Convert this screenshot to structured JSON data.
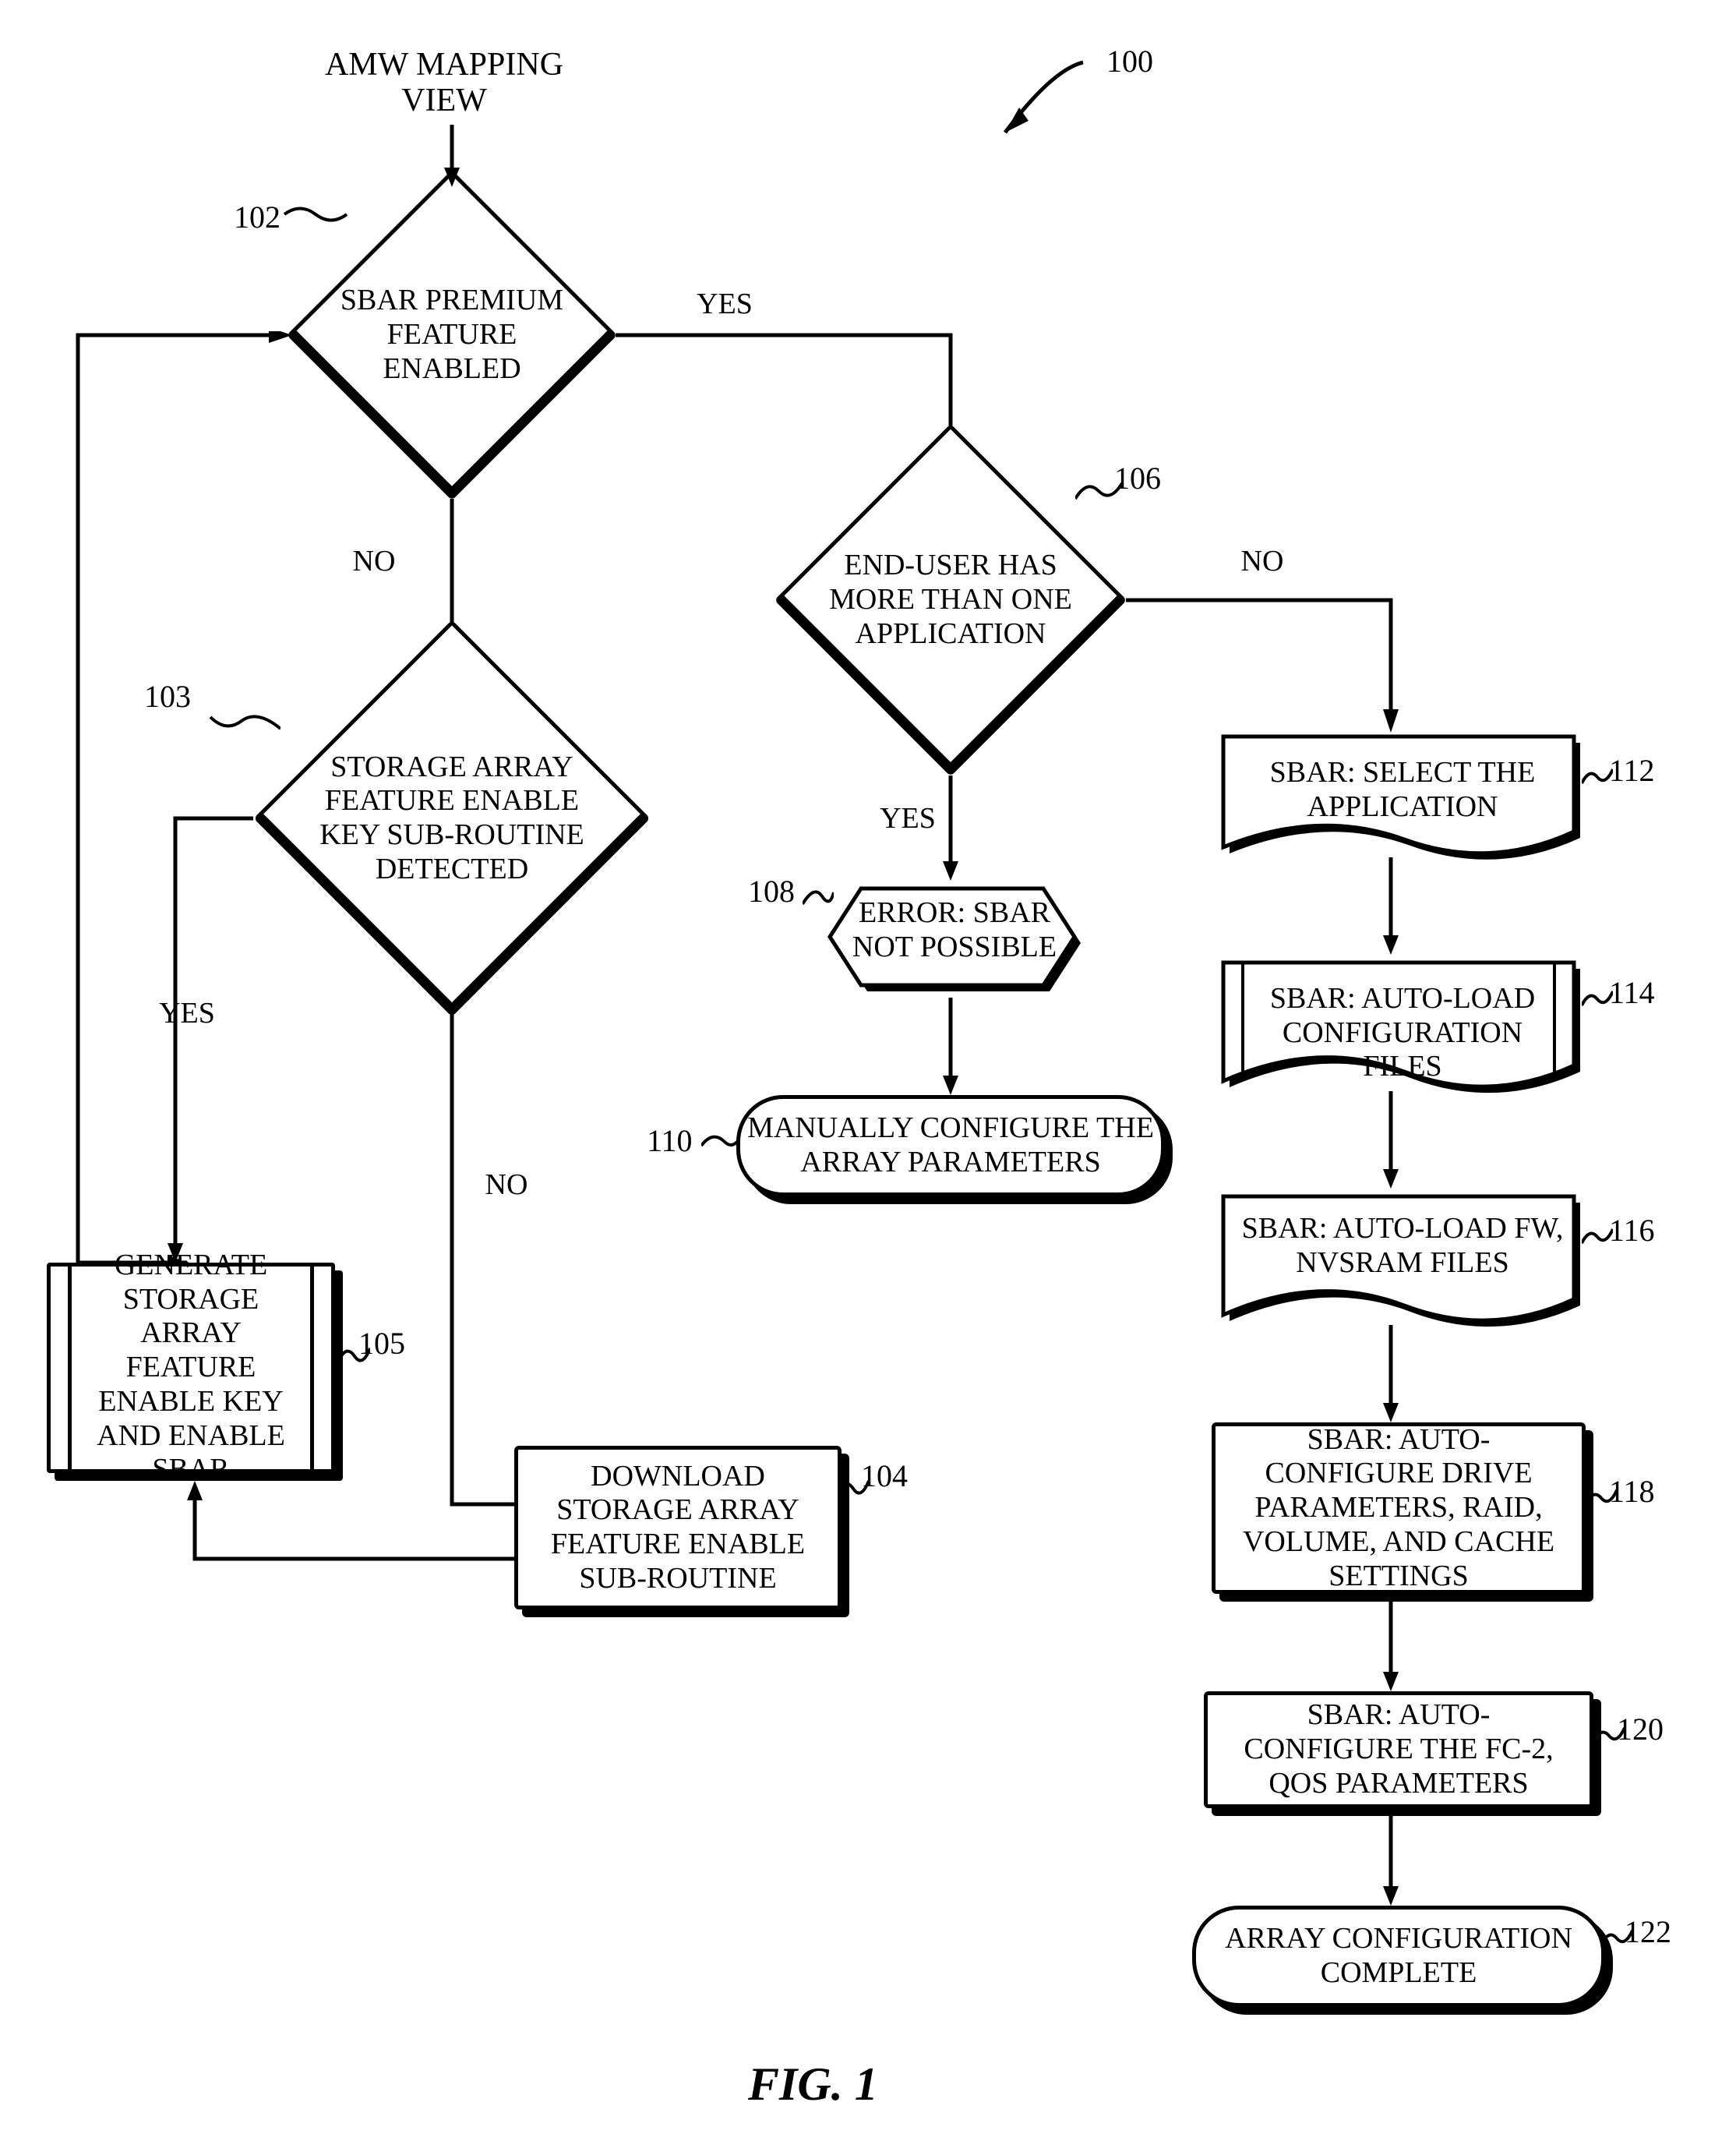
{
  "title": "AMW MAPPING VIEW",
  "ref_arrow": "100",
  "caption": "FIG. 1",
  "nodes": {
    "d102": {
      "text": "SBAR PREMIUM FEATURE ENABLED",
      "ref": "102"
    },
    "d103": {
      "text": "STORAGE ARRAY FEATURE ENABLE KEY SUB-ROUTINE DETECTED",
      "ref": "103"
    },
    "p105": {
      "text": "GENERATE STORAGE ARRAY FEATURE ENABLE KEY AND ENABLE SBAR",
      "ref": "105"
    },
    "p104": {
      "text": "DOWNLOAD STORAGE ARRAY FEATURE ENABLE SUB-ROUTINE",
      "ref": "104"
    },
    "d106": {
      "text": "END-USER HAS MORE THAN ONE APPLICATION",
      "ref": "106"
    },
    "h108": {
      "text": "ERROR:  SBAR NOT POSSIBLE",
      "ref": "108"
    },
    "t110": {
      "text": "MANUALLY CONFIGURE THE ARRAY PARAMETERS",
      "ref": "110"
    },
    "c112": {
      "text": "SBAR:  SELECT THE APPLICATION",
      "ref": "112"
    },
    "c114": {
      "text": "SBAR:  AUTO-LOAD CONFIGURATION FILES",
      "ref": "114"
    },
    "c116": {
      "text": "SBAR:  AUTO-LOAD FW, NVSRAM FILES",
      "ref": "116"
    },
    "p118": {
      "text": "SBAR:  AUTO-CONFIGURE DRIVE PARAMETERS, RAID, VOLUME, AND CACHE SETTINGS",
      "ref": "118"
    },
    "p120": {
      "text": "SBAR:  AUTO-CONFIGURE THE FC-2, QOS PARAMETERS",
      "ref": "120"
    },
    "t122": {
      "text": "ARRAY CONFIGURATION COMPLETE",
      "ref": "122"
    }
  },
  "edges": {
    "yes": "YES",
    "no": "NO"
  }
}
